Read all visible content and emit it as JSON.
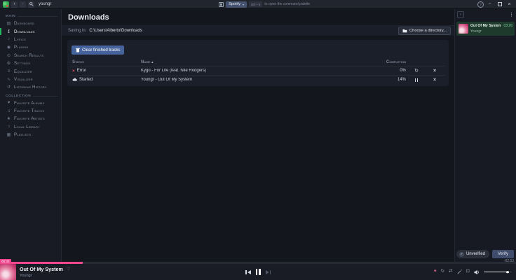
{
  "topbar": {
    "search_query": "youngr",
    "provider": {
      "label": "Spotify"
    },
    "shortcut": "ctrl + k",
    "shortcut_hint": "to open the command palette"
  },
  "icons": {
    "back": "‹",
    "forward": "›",
    "caret": "▾",
    "kebab": "⋮",
    "collapse": "›",
    "help": "?",
    "minimize": "−",
    "close": "×",
    "check": "✓",
    "retry": "↻",
    "remove": "×",
    "repeat": "↻",
    "shuffle": "⇄",
    "heart_outline": "♡",
    "heart": "♥",
    "sort_asc": "▴",
    "compress": "⊡"
  },
  "sidebar": {
    "sections": [
      {
        "title": "Main",
        "items": [
          {
            "label": "Dashboard",
            "glyph": "▤"
          },
          {
            "label": "Downloads",
            "glyph": "↧",
            "active": true
          },
          {
            "label": "Lyrics",
            "glyph": "♪"
          },
          {
            "label": "Plugins",
            "glyph": "◉"
          },
          {
            "label": "Search Results",
            "glyph": "⊙"
          },
          {
            "label": "Settings",
            "glyph": "⚙"
          },
          {
            "label": "Equalizer",
            "glyph": "≡"
          },
          {
            "label": "Visualizer",
            "glyph": "∿"
          },
          {
            "label": "Listening History",
            "glyph": "↺"
          }
        ]
      },
      {
        "title": "Collection",
        "items": [
          {
            "label": "Favorite Albums",
            "glyph": "♥"
          },
          {
            "label": "Favorite Tracks",
            "glyph": "♫"
          },
          {
            "label": "Favorite Artists",
            "glyph": "★"
          },
          {
            "label": "Local Library",
            "glyph": "⌂"
          },
          {
            "label": "Playlists",
            "glyph": "▦"
          }
        ]
      }
    ]
  },
  "downloads": {
    "title": "Downloads",
    "saving_in_label": "Saving in:",
    "saving_path": "C:\\Users\\Alberto\\Downloads",
    "choose_directory_label": "Choose a directory...",
    "clear_finished_label": "Clear finished tracks",
    "columns": {
      "status": "Status",
      "name": "Name",
      "completion": "Completion"
    },
    "rows": [
      {
        "status": "Error",
        "name": "Kygo - For Life (feat. Nile Rodgers)",
        "completion": "0%"
      },
      {
        "status": "Started",
        "name": "Youngr - Out Of My System",
        "completion": "14%"
      }
    ]
  },
  "queue": {
    "current_track": {
      "title": "Out Of My System",
      "artist": "Youngr",
      "duration": "03:26"
    }
  },
  "verification": {
    "status_label": "Unverified",
    "verify_button": "Verify"
  },
  "player": {
    "elapsed": "00:32",
    "remaining": "-02:53",
    "track": {
      "title": "Out Of My System",
      "artist": "Youngr"
    },
    "progress_pct": 16,
    "volume_pct": 85
  },
  "colors": {
    "accent_green": "#1db954",
    "accent_pink": "#f1478f",
    "accent_blue": "#47639c"
  }
}
